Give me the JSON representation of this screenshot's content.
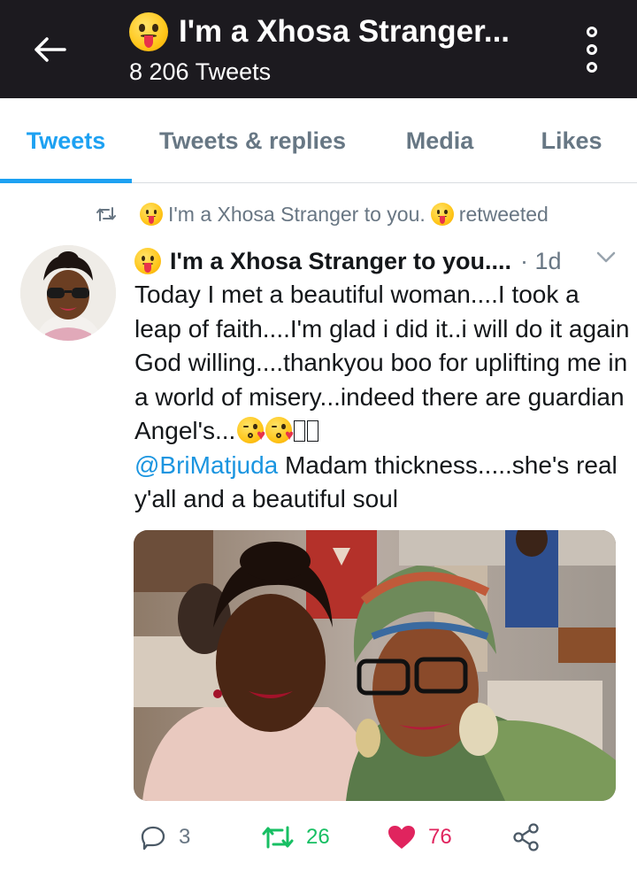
{
  "header": {
    "title": "I'm a Xhosa Stranger...",
    "subtitle": "8 206 Tweets",
    "back_icon": "arrow-left-icon",
    "menu_icon": "more-vertical-icon"
  },
  "tabs": [
    {
      "label": "Tweets",
      "active": true
    },
    {
      "label": "Tweets & replies",
      "active": false
    },
    {
      "label": "Media",
      "active": false
    },
    {
      "label": "Likes",
      "active": false
    }
  ],
  "retweet": {
    "name": "I'm a Xhosa Stranger to you.",
    "suffix": "retweeted"
  },
  "tweet": {
    "author": "I'm a Xhosa Stranger to you....",
    "time": "· 1d",
    "text_main": "Today I met a beautiful woman....I took a leap of faith....I'm glad i did it..i will do it again God willing....thankyou boo for uplifting me in a world of misery...indeed there are guardian Angel's...",
    "mention": "@BriMatjuda",
    "text_after": " Madam thickness.....she's real y'all and a beautiful soul",
    "replies": "3",
    "retweets": "26",
    "likes": "76"
  },
  "colors": {
    "header_bg": "#1c1a1f",
    "accent": "#1da1f2",
    "retweet_green": "#17bf63",
    "like_red": "#e0245e",
    "muted": "#687683"
  }
}
